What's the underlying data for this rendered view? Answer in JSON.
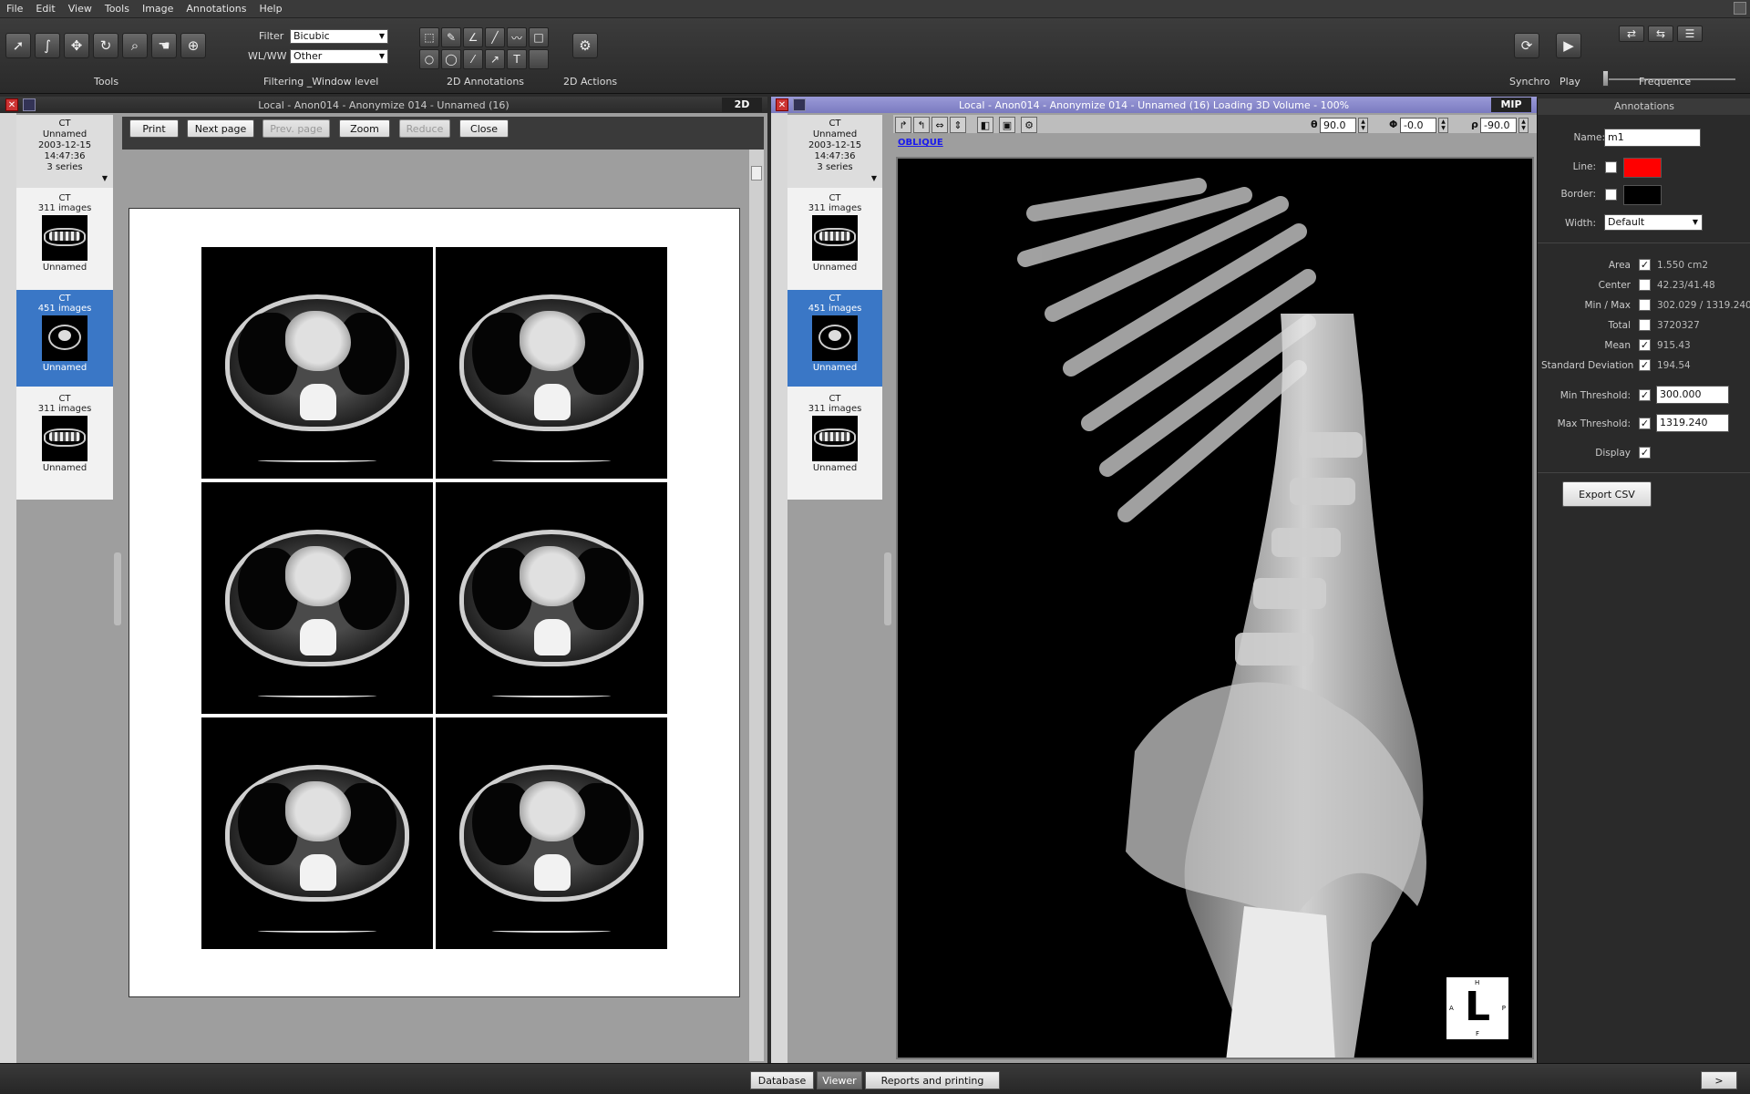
{
  "menu": [
    "File",
    "Edit",
    "View",
    "Tools",
    "Image",
    "Annotations",
    "Help"
  ],
  "toolbar": {
    "tools_label": "Tools",
    "filter_label": "Filter",
    "filter_value": "Bicubic",
    "wlww_label": "WL/WW",
    "wlww_value": "Other",
    "filtering_label": "Filtering _Window level",
    "annotations2d_label": "2D Annotations",
    "actions2d_label": "2D Actions",
    "synchro_label": "Synchro",
    "play_label": "Play",
    "frequence_label": "Frequence"
  },
  "left_viewer": {
    "title": "Local - Anon014 - Anonymize 014 - Unnamed (16)",
    "mode_badge": "2D",
    "buttons": {
      "print": "Print",
      "next": "Next page",
      "prev": "Prev. page",
      "zoom": "Zoom",
      "reduce": "Reduce",
      "close": "Close"
    }
  },
  "study": {
    "modality": "CT",
    "name": "Unnamed",
    "datetime": "2003-12-15 14:47:36",
    "series_count": "3 series"
  },
  "series": [
    {
      "modality": "CT",
      "images": "311 images",
      "name": "Unnamed",
      "selected": false
    },
    {
      "modality": "CT",
      "images": "451 images",
      "name": "Unnamed",
      "selected": true
    },
    {
      "modality": "CT",
      "images": "311 images",
      "name": "Unnamed",
      "selected": false
    }
  ],
  "right_viewer": {
    "title": "Local - Anon014 - Anonymize 014 - Unnamed (16) Loading 3D Volume - 100%",
    "mode_badge": "MIP",
    "oblique_link": "OBLIQUE",
    "theta_symbol": "θ",
    "theta_value": "90.0",
    "phi_symbol": "Φ",
    "phi_value": "-0.0",
    "rho_symbol": "ρ",
    "rho_value": "-90.0",
    "orientation": {
      "top": "H",
      "left": "A",
      "right": "P",
      "bottom": "F",
      "center": "L"
    }
  },
  "annotations": {
    "header": "Annotations",
    "name_label": "Name:",
    "name_value": "m1",
    "line_label": "Line:",
    "line_color": "#ff0000",
    "border_label": "Border:",
    "border_color": "#000000",
    "width_label": "Width:",
    "width_value": "Default",
    "stats": [
      {
        "label": "Area",
        "checked": true,
        "value": "1.550 cm2"
      },
      {
        "label": "Center",
        "checked": false,
        "value": "42.23/41.48"
      },
      {
        "label": "Min / Max",
        "checked": false,
        "value": "302.029 / 1319.240"
      },
      {
        "label": "Total",
        "checked": false,
        "value": "3720327"
      },
      {
        "label": "Mean",
        "checked": true,
        "value": "915.43"
      },
      {
        "label": "Standard Deviation",
        "checked": true,
        "value": "194.54"
      }
    ],
    "min_threshold_label": "Min Threshold:",
    "min_threshold_value": "300.000",
    "max_threshold_label": "Max Threshold:",
    "max_threshold_value": "1319.240",
    "display_label": "Display",
    "export_button": "Export CSV"
  },
  "statusbar": {
    "tabs": [
      "Database",
      "Viewer",
      "Reports and printing"
    ],
    "active": "Viewer",
    "more": ">"
  }
}
